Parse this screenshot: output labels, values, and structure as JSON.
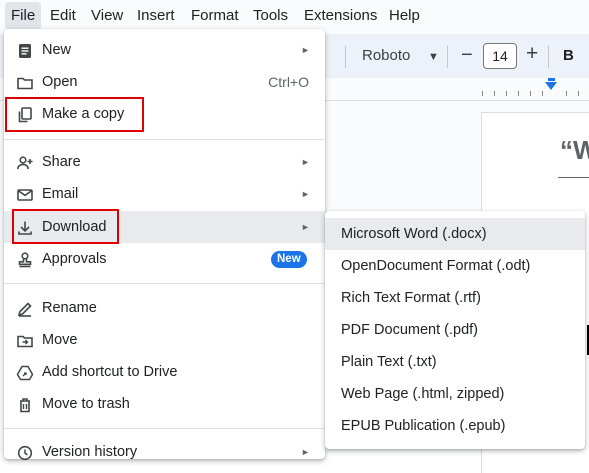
{
  "menubar": {
    "items": [
      "File",
      "Edit",
      "View",
      "Insert",
      "Format",
      "Tools",
      "Extensions",
      "Help"
    ]
  },
  "toolbar": {
    "font": "Roboto",
    "font_size": "14",
    "minus": "−",
    "plus": "+",
    "bold": "B"
  },
  "document": {
    "title_fragment": "“W"
  },
  "file_menu": {
    "new": "New",
    "open": "Open",
    "open_shortcut": "Ctrl+O",
    "make_copy": "Make a copy",
    "share": "Share",
    "email": "Email",
    "download": "Download",
    "approvals": "Approvals",
    "approvals_badge": "New",
    "rename": "Rename",
    "move": "Move",
    "add_shortcut": "Add shortcut to Drive",
    "move_to_trash": "Move to trash",
    "version_history": "Version history"
  },
  "download_submenu": {
    "items": [
      "Microsoft Word (.docx)",
      "OpenDocument Format (.odt)",
      "Rich Text Format (.rtf)",
      "PDF Document (.pdf)",
      "Plain Text (.txt)",
      "Web Page (.html, zipped)",
      "EPUB Publication (.epub)"
    ]
  },
  "icons": {
    "arrow": "►",
    "caret": "▼"
  },
  "colors": {
    "highlight_box": "#e00000",
    "badge": "#1a73e8",
    "hover": "#e8eaed"
  }
}
